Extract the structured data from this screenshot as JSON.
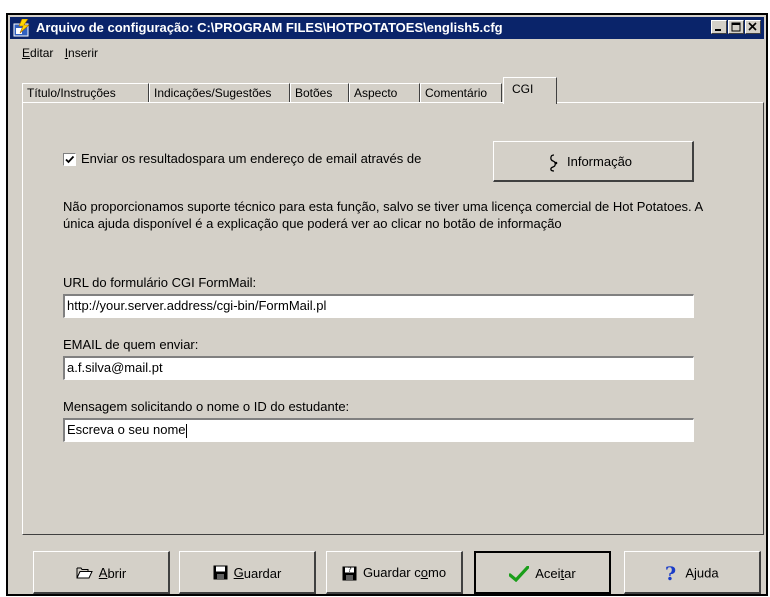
{
  "window": {
    "title": "Arquivo de configuração: C:\\PROGRAM FILES\\HOTPOTATOES\\english5.cfg"
  },
  "menu": [
    {
      "label": "Editar"
    },
    {
      "label": "Inserir"
    }
  ],
  "tabs": [
    {
      "label": "Título/Instruções"
    },
    {
      "label": "Indicações/Sugestões"
    },
    {
      "label": "Botões"
    },
    {
      "label": "Aspecto"
    },
    {
      "label": "Comentário"
    },
    {
      "label": "CGI",
      "active": true
    }
  ],
  "cgi": {
    "send_checkbox_label": "Enviar os resultadospara um endereço de email através de",
    "send_checked": true,
    "info_button": "Informação",
    "notice": "Não proporcionamos suporte técnico para esta função, salvo se tiver uma licença comercial de Hot Potatoes.  A única ajuda disponível é a explicação que poderá ver ao clicar no botão de informação",
    "url_label": "URL do formulário CGI FormMail:",
    "url_value": "http://your.server.address/cgi-bin/FormMail.pl",
    "email_label": "EMAIL de quem enviar:",
    "email_value": "a.f.silva@mail.pt",
    "msg_label": "Mensagem solicitando o nome o ID do estudante:",
    "msg_value": "Escreva o seu nome"
  },
  "buttons": {
    "open": "Abrir",
    "save": "Guardar",
    "save_as": "Guardar como",
    "accept": "Aceitar",
    "help": "Ajuda"
  },
  "colors": {
    "titlebar": "#0a246a",
    "face": "#d4d0c8",
    "accept_check": "#1a9e1a",
    "help_icon": "#1a3cc8"
  }
}
